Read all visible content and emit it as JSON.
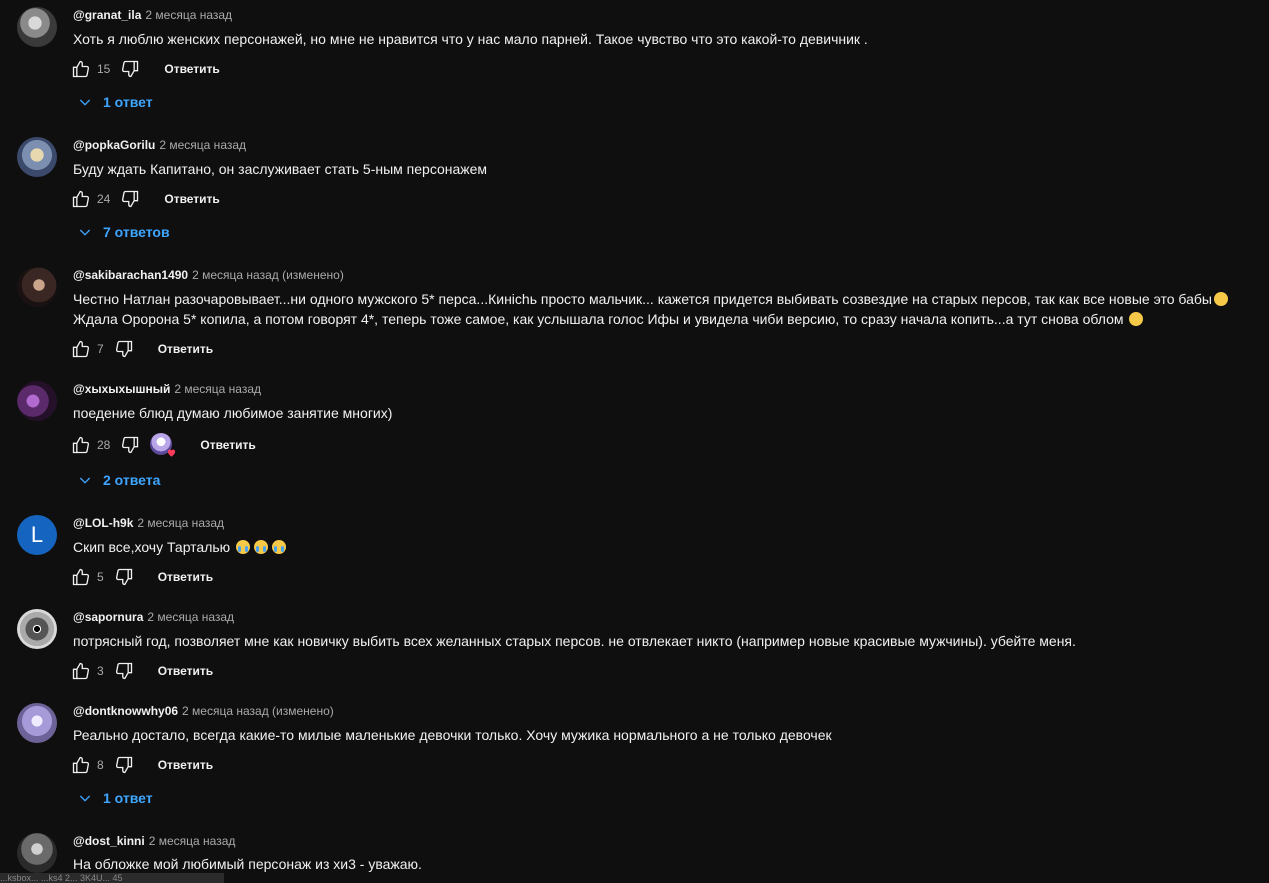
{
  "ui": {
    "reply_label": "Ответить"
  },
  "comments": [
    {
      "author": "@granat_ila",
      "time": "2 месяца назад",
      "text": "Хоть я люблю женских персонажей, но мне не нравится что у нас мало парней. Такое чувство что это какой-то девичник .",
      "likes": "15",
      "replies": "1 ответ",
      "avatar": "avatar-grey-character"
    },
    {
      "author": "@popkaGorilu",
      "time": "2 месяца назад",
      "text": "Буду ждать Капитано, он заслуживает стать 5-ным персонажем",
      "likes": "24",
      "replies": "7 ответов",
      "avatar": "avatar-anime-blonde"
    },
    {
      "author": "@sakibarachan1490",
      "time": "2 месяца назад (изменено)",
      "text": "Честно Натлан разочаровывает...ни одного мужского 5* перса...Кинichь просто мальчик... кажется придется выбивать созвездие на старых персов, так как все новые это бабы",
      "text2": "Ждала Оророна 5* копила, а потом говорят 4*, теперь тоже самое, как услышала голос Ифы и увидела чиби версию, то сразу начала копить...а тут снова облом",
      "likes": "7",
      "avatar": "avatar-dark-hair"
    },
    {
      "author": "@хыхыхышный",
      "time": "2 месяца назад",
      "text": "поедение блюд думаю любимое занятие многих)",
      "likes": "28",
      "replies": "2 ответа",
      "avatar": "avatar-purple-art"
    },
    {
      "author": "@LOL-h9k",
      "time": "2 месяца назад",
      "text": "Скип все,хочу Тарталью",
      "likes": "5",
      "avatar_letter": "L"
    },
    {
      "author": "@sapornura",
      "time": "2 месяца назад",
      "text": "потрясный год, позволяет мне как новичку выбить всех желанных старых персов. не отвлекает никто (например новые красивые мужчины). убейте меня.",
      "likes": "3",
      "avatar": "avatar-eye"
    },
    {
      "author": "@dontknowwhy06",
      "time": "2 месяца назад (изменено)",
      "text": "Реально достало, всегда какие-то милые маленькие девочки только. Хочу мужика нормального а не только девочек",
      "likes": "8",
      "replies": "1 ответ",
      "avatar": "avatar-lavender-art"
    },
    {
      "author": "@dost_kinni",
      "time": "2 месяца назад",
      "text": "На обложке мой любимый персонаж из хи3 - уважаю.",
      "avatar": "avatar-manga-grey"
    }
  ],
  "footer_overlay": "...ksbox... ...ks4 2... 3K4U... 45"
}
